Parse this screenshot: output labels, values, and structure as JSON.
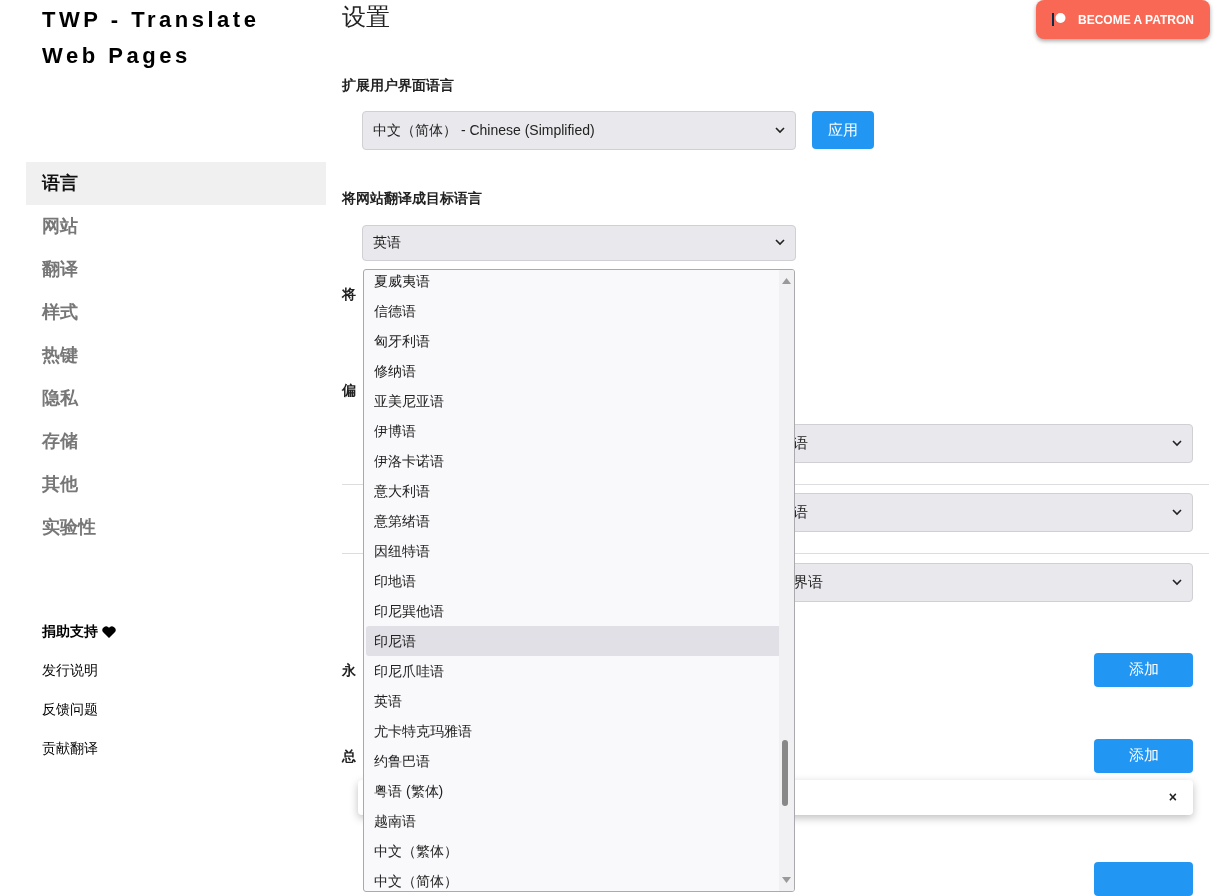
{
  "app_title": "TWP - Translate Web Pages",
  "sidebar": {
    "items": [
      {
        "label": "语言",
        "selected": true
      },
      {
        "label": "网站",
        "selected": false
      },
      {
        "label": "翻译",
        "selected": false
      },
      {
        "label": "样式",
        "selected": false
      },
      {
        "label": "热键",
        "selected": false
      },
      {
        "label": "隐私",
        "selected": false
      },
      {
        "label": "存储",
        "selected": false
      },
      {
        "label": "其他",
        "selected": false
      },
      {
        "label": "实验性",
        "selected": false
      }
    ],
    "links": [
      {
        "label": "捐助支持",
        "kind": "donate"
      },
      {
        "label": "发行说明",
        "kind": "plain"
      },
      {
        "label": "反馈问题",
        "kind": "plain"
      },
      {
        "label": "贡献翻译",
        "kind": "plain"
      }
    ]
  },
  "page_title": "设置",
  "patron_button": "BECOME A PATRON",
  "ui_language": {
    "label": "扩展用户界面语言",
    "value": "中文（简体） - Chinese (Simplified)",
    "button": "应用"
  },
  "target_language": {
    "label": "将网站翻译成目标语言",
    "value": "英语"
  },
  "covered_label_1": "将",
  "covered_label_2": "偏",
  "preferred_rows": [
    {
      "value": "语"
    },
    {
      "value": "语"
    },
    {
      "value": "界语"
    }
  ],
  "add_rows": [
    {
      "label": "永",
      "button": "添加"
    },
    {
      "label": "总",
      "button": "添加"
    }
  ],
  "toast": {
    "close": "×"
  },
  "dropdown": {
    "options": [
      {
        "label": "夏威夷语",
        "selected": false
      },
      {
        "label": "信德语",
        "selected": false
      },
      {
        "label": "匈牙利语",
        "selected": false
      },
      {
        "label": "修纳语",
        "selected": false
      },
      {
        "label": "亚美尼亚语",
        "selected": false
      },
      {
        "label": "伊博语",
        "selected": false
      },
      {
        "label": "伊洛卡诺语",
        "selected": false
      },
      {
        "label": "意大利语",
        "selected": false
      },
      {
        "label": "意第绪语",
        "selected": false
      },
      {
        "label": "因纽特语",
        "selected": false
      },
      {
        "label": "印地语",
        "selected": false
      },
      {
        "label": "印尼巽他语",
        "selected": false
      },
      {
        "label": "印尼语",
        "selected": true
      },
      {
        "label": "印尼爪哇语",
        "selected": false
      },
      {
        "label": "英语",
        "selected": false
      },
      {
        "label": "尤卡特克玛雅语",
        "selected": false
      },
      {
        "label": "约鲁巴语",
        "selected": false
      },
      {
        "label": "粤语 (繁体)",
        "selected": false
      },
      {
        "label": "越南语",
        "selected": false
      },
      {
        "label": "中文（繁体）",
        "selected": false
      },
      {
        "label": "中文（简体）",
        "selected": false
      }
    ]
  }
}
